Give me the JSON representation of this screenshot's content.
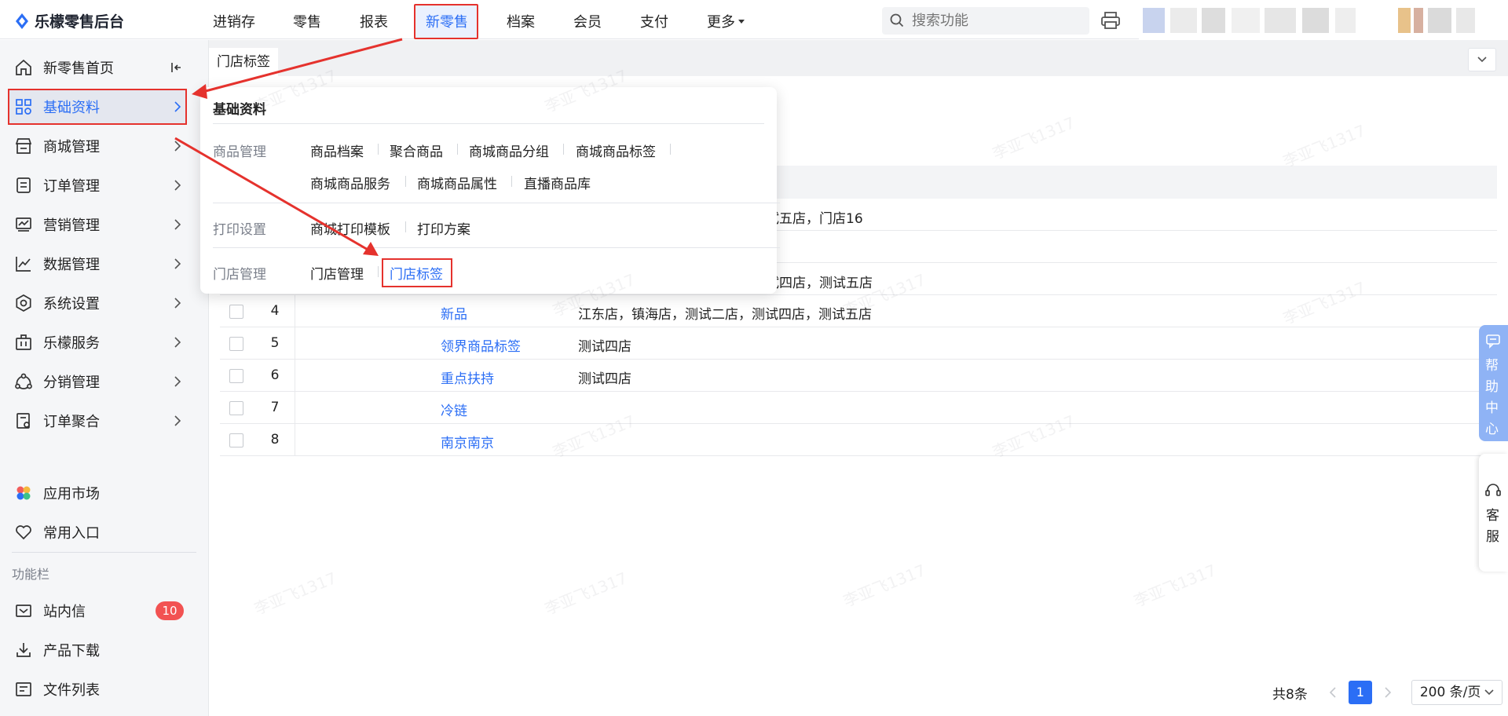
{
  "app": {
    "title": "乐檬零售后台"
  },
  "topnav": {
    "items": [
      "进销存",
      "零售",
      "报表",
      "新零售",
      "档案",
      "会员",
      "支付",
      "更多"
    ],
    "active": "新零售"
  },
  "search": {
    "placeholder": "搜索功能"
  },
  "sidebar": {
    "items": [
      {
        "label": "新零售首页",
        "icon": "home-icon"
      },
      {
        "label": "基础资料",
        "icon": "grid-icon"
      },
      {
        "label": "商城管理",
        "icon": "store-icon"
      },
      {
        "label": "订单管理",
        "icon": "order-icon"
      },
      {
        "label": "营销管理",
        "icon": "marketing-icon"
      },
      {
        "label": "数据管理",
        "icon": "chart-icon"
      },
      {
        "label": "系统设置",
        "icon": "settings-icon"
      },
      {
        "label": "乐檬服务",
        "icon": "briefcase-icon"
      },
      {
        "label": "分销管理",
        "icon": "share-icon"
      },
      {
        "label": "订单聚合",
        "icon": "aggregate-icon"
      }
    ],
    "extra": [
      {
        "label": "应用市场",
        "icon": "app-market-icon"
      },
      {
        "label": "常用入口",
        "icon": "heart-icon"
      }
    ],
    "section_title": "功能栏",
    "tools": [
      {
        "label": "站内信",
        "icon": "mail-icon",
        "badge": "10"
      },
      {
        "label": "产品下载",
        "icon": "download-icon"
      },
      {
        "label": "文件列表",
        "icon": "file-list-icon"
      }
    ]
  },
  "tabs": [
    {
      "label": "门店标签"
    }
  ],
  "table": {
    "rows": [
      {
        "num": "4",
        "name": "新品",
        "stores": "江东店，镇海店，测试二店，测试四店，测试五店"
      },
      {
        "num": "5",
        "name": "领界商品标签",
        "stores": "测试四店"
      },
      {
        "num": "6",
        "name": "重点扶持",
        "stores": "测试四店"
      },
      {
        "num": "7",
        "name": "冷链",
        "stores": ""
      },
      {
        "num": "8",
        "name": "南京南京",
        "stores": ""
      }
    ],
    "partial_stores": [
      "试五店，门店16",
      "试四店，测试五店"
    ]
  },
  "pagination": {
    "total": "共8条",
    "page": "1",
    "size": "200 条/页"
  },
  "dropdown": {
    "title": "基础资料",
    "groups": [
      {
        "category": "商品管理",
        "links": [
          "商品档案",
          "聚合商品",
          "商城商品分组",
          "商城商品标签",
          "商城商品服务",
          "商城商品属性",
          "直播商品库"
        ]
      },
      {
        "category": "打印设置",
        "links": [
          "商城打印模板",
          "打印方案"
        ]
      },
      {
        "category": "门店管理",
        "links": [
          "门店管理",
          "门店标签"
        ]
      }
    ]
  },
  "help": {
    "label": [
      "帮",
      "助",
      "中",
      "心"
    ]
  },
  "kefu": {
    "label": [
      "客",
      "服"
    ]
  },
  "watermark": "李亚飞1317",
  "colors": {
    "accent": "#2b6ef5",
    "highlight": "#e5322d",
    "badge": "#f25252"
  }
}
